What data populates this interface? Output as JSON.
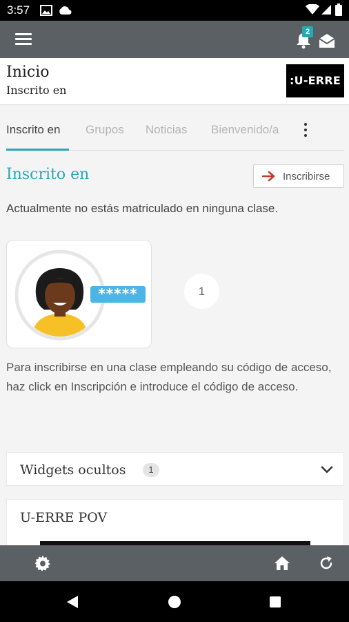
{
  "status_bar": {
    "time": "3:57"
  },
  "app_bar": {
    "notification_count": "2"
  },
  "header": {
    "title": "Inicio",
    "subtitle": "Inscrito en",
    "logo_text": ":U-ERRE"
  },
  "tabs": [
    {
      "label": "Inscrito en",
      "active": true
    },
    {
      "label": "Grupos",
      "active": false
    },
    {
      "label": "Noticias",
      "active": false
    },
    {
      "label": "Bienvenido/a",
      "active": false
    }
  ],
  "section": {
    "title": "Inscrito en",
    "enroll_button": "Inscribirse",
    "empty_message": "Actualmente no estás matriculado en ninguna clase.",
    "step_number": "1",
    "password_mask": "*****",
    "instructions": "Para inscribirse en una clase empleando su código de acceso, haz click en Inscripción e introduce el código de acceso."
  },
  "widgets": {
    "title": "Widgets ocultos",
    "count": "1"
  },
  "pov": {
    "title": "U-ERRE POV"
  },
  "colors": {
    "accent": "#2aa6b7",
    "app_bar": "#5b6065",
    "arrow": "#c0392b"
  },
  "icons": [
    "menu-icon",
    "bell-icon",
    "mail-icon",
    "kebab-icon",
    "arrow-right-icon",
    "chevron-down-icon",
    "gear-icon",
    "home-icon",
    "refresh-icon",
    "back-icon",
    "home-nav-icon",
    "recents-icon"
  ]
}
